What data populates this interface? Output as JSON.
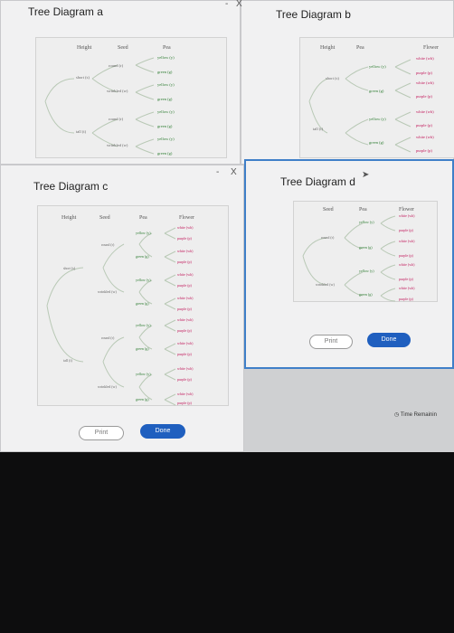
{
  "window_a": {
    "title": "Tree Diagram a",
    "headers": [
      "Height",
      "Seed",
      "Pea"
    ],
    "height_labels": [
      "short (s)",
      "tall (t)"
    ],
    "seed_labels": [
      "round (r)",
      "wrinkled (w)",
      "round (r)",
      "wrinkled (w)"
    ],
    "pea_labels": [
      "yellow (y)",
      "green (g)",
      "yellow (y)",
      "green (g)",
      "yellow (y)",
      "green (g)",
      "yellow (y)",
      "green (g)"
    ]
  },
  "window_b": {
    "title": "Tree Diagram b",
    "headers": [
      "Height",
      "Pea",
      "Flower"
    ],
    "height_labels": [
      "short (s)",
      "tall (t)"
    ],
    "pea_labels": [
      "yellow (y)",
      "green (g)",
      "yellow (y)",
      "green (g)"
    ],
    "flower_labels": [
      "white (wh)",
      "purple (p)",
      "white (wh)",
      "purple (p)",
      "white (wh)",
      "purple (p)",
      "white (wh)",
      "purple (p)"
    ]
  },
  "window_c": {
    "title": "Tree Diagram c",
    "headers": [
      "Height",
      "Seed",
      "Pea",
      "Flower"
    ],
    "height_labels": [
      "short (s)",
      "tall (t)"
    ],
    "seed_labels": [
      "round (r)",
      "wrinkled (w)",
      "round (r)",
      "wrinkled (w)"
    ],
    "pea_labels": [
      "yellow (y)",
      "green (g)",
      "yellow (y)",
      "green (g)",
      "yellow (y)",
      "green (g)",
      "yellow (y)",
      "green (g)"
    ],
    "flower_labels": [
      "white (wh)",
      "purple (p)",
      "white (wh)",
      "purple (p)",
      "white (wh)",
      "purple (p)",
      "white (wh)",
      "purple (p)",
      "white (wh)",
      "purple (p)",
      "white (wh)",
      "purple (p)",
      "white (wh)",
      "purple (p)",
      "white (wh)",
      "purple (p)"
    ],
    "print_label": "Print",
    "done_label": "Done"
  },
  "window_d": {
    "title": "Tree Diagram d",
    "headers": [
      "Seed",
      "Pea",
      "Flower"
    ],
    "seed_labels": [
      "round (r)",
      "wrinkled (w)"
    ],
    "pea_labels": [
      "yellow (y)",
      "green (g)",
      "yellow (y)",
      "green (g)"
    ],
    "flower_labels": [
      "white (wh)",
      "purple (p)",
      "white (wh)",
      "purple (p)",
      "white (wh)",
      "purple (p)",
      "white (wh)",
      "purple (p)"
    ],
    "print_label": "Print",
    "done_label": "Done"
  },
  "status": {
    "time_remaining": "Time Remainin"
  },
  "controls": {
    "minimize": "-",
    "close": "X"
  }
}
